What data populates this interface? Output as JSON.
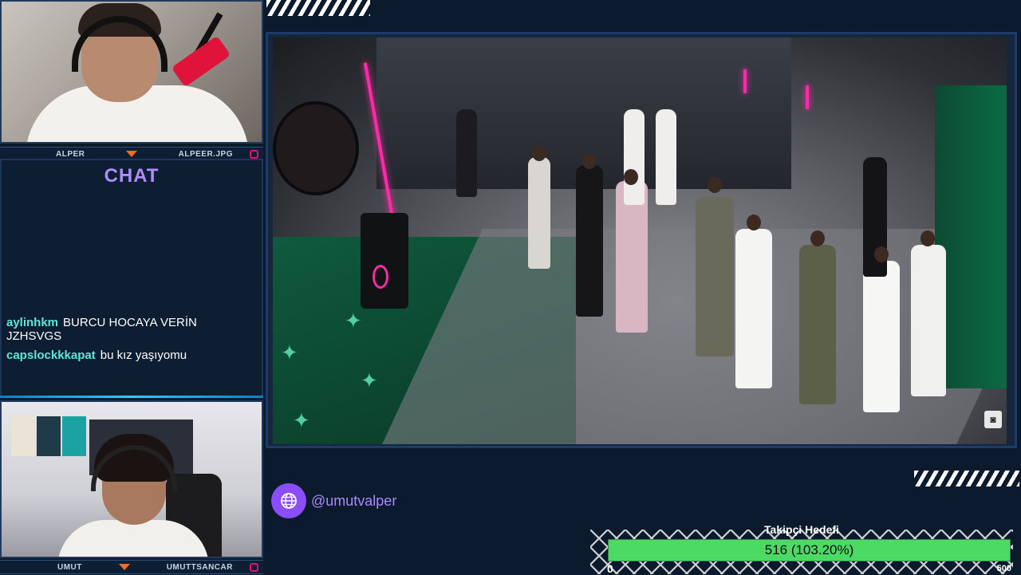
{
  "streamer_top": {
    "name": "ALPER",
    "handle": "ALPEER.JPG"
  },
  "chat": {
    "title": "CHAT",
    "messages": [
      {
        "user": "aylinhkm",
        "text": "BURCU HOCAYA VERİN JZHSVGS"
      },
      {
        "user": "capslockkkapat",
        "text": "bu kız yaşıyomu"
      }
    ]
  },
  "streamer_bottom": {
    "name": "UMUT",
    "handle": "UMUTTSANCAR"
  },
  "social": {
    "handle": "@umutvalper",
    "icon": "globe-icon"
  },
  "goal": {
    "title": "Takipçi Hedefi",
    "value_text": "516 (103.20%)",
    "progress_fraction": 1.0,
    "min_label": "0",
    "max_label": "500"
  },
  "colors": {
    "accent_purple": "#8a4dff",
    "chat_user": "#5fe7d6",
    "goal_fill": "#4cd964",
    "caret": "#ff6a1a"
  }
}
